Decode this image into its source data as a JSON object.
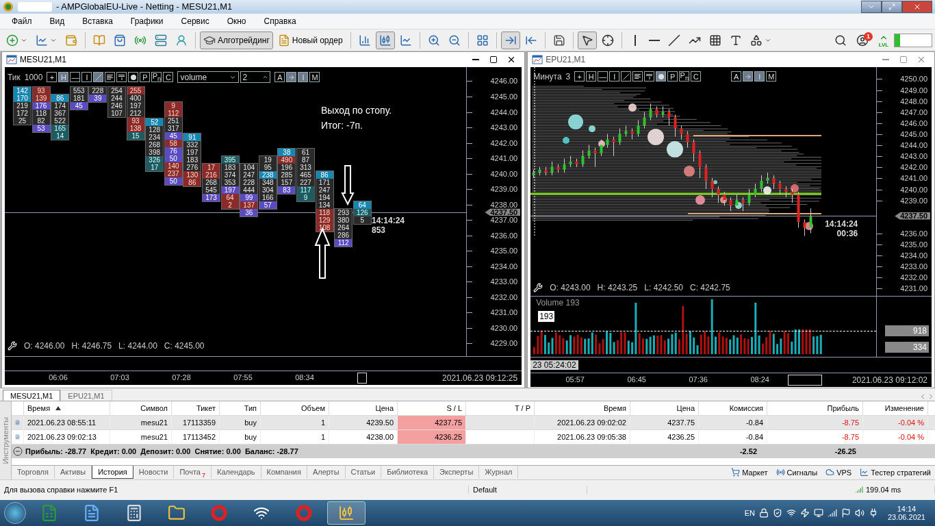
{
  "window": {
    "title": "- AMPGlobalEU-Live - Netting - MESU21,M1"
  },
  "menu": [
    "Файл",
    "Вид",
    "Вставка",
    "Графики",
    "Сервис",
    "Окно",
    "Справка"
  ],
  "toolbar": {
    "algo_button": {
      "label": "Алготрейдинг",
      "selected": true
    },
    "order_button": {
      "label": "Новый ордер"
    },
    "chart_modes": [
      {
        "selected": false
      },
      {
        "selected": true
      },
      {
        "selected": false
      }
    ],
    "autoscroll": {
      "selected": true
    },
    "cursor": {
      "selected": true
    },
    "notification_count": "1",
    "level_label": "LVL"
  },
  "charts": [
    {
      "kind": "footprint",
      "title": "MESU21,M1",
      "period_label": "Тик",
      "period_value": "1000",
      "tools": [
        {
          "kind": "char",
          "label": "+",
          "selected": false
        },
        {
          "kind": "char",
          "label": "H",
          "selected": true
        },
        {
          "kind": "char",
          "label": "—",
          "selected": false
        },
        {
          "kind": "char",
          "label": "I",
          "selected": false
        },
        {
          "kind": "slash",
          "selected": true
        },
        {
          "kind": "lines",
          "selected": false
        },
        {
          "kind": "strike",
          "selected": false
        },
        {
          "kind": "dot",
          "selected": false
        },
        {
          "kind": "char",
          "label": "P",
          "selected": false
        },
        {
          "kind": "char",
          "label": "P$_{n}$",
          "selected": false
        },
        {
          "kind": "char",
          "label": "C",
          "selected": false
        }
      ],
      "dropdown": {
        "value": "volume"
      },
      "spinner": {
        "value": "2"
      },
      "extra_tools": [
        {
          "kind": "char",
          "label": "A",
          "selected": false
        },
        {
          "kind": "arrow",
          "selected": true
        },
        {
          "kind": "char",
          "label": "I",
          "selected": true
        },
        {
          "kind": "char",
          "label": "M",
          "selected": false
        }
      ],
      "price_labels": [
        "4246.00",
        "4245.00",
        "4244.00",
        "4243.00",
        "4242.00",
        "4241.00",
        "4240.00",
        "4239.00",
        "4238.00",
        "4237.00",
        "4236.00",
        "4235.00",
        "4234.00",
        "4233.00",
        "4232.00",
        "4231.00",
        "4230.00",
        "4229.00"
      ],
      "price_marker": "4237.50",
      "last_time": "14:14:24",
      "last_value": "853",
      "note": [
        "Выход по стопу.",
        "Итог: -7п."
      ],
      "ohlc": [
        "O: 4246.00",
        "H: 4246.75",
        "L: 4244.00",
        "C: 4245.00"
      ],
      "time_labels": [
        "06:06",
        "07:03",
        "07:28",
        "07:55",
        "08:34"
      ],
      "date_label": "2021.06.23 09:12:25",
      "footprint": [
        [
          {
            "text": "142",
            "kind": "ask"
          },
          {
            "text": "170",
            "kind": "ask"
          },
          {
            "text": "219",
            "kind": "plain"
          },
          {
            "text": "172",
            "kind": "plain"
          },
          {
            "text": "25",
            "kind": "plain"
          }
        ],
        [
          {
            "text": "93",
            "kind": "red"
          },
          {
            "text": "139",
            "kind": "red"
          },
          {
            "text": "176",
            "kind": "bid"
          },
          {
            "text": "118",
            "kind": "plain"
          },
          {
            "text": "82",
            "kind": "plain"
          },
          {
            "text": "53",
            "kind": "bid"
          }
        ],
        [
          {
            "text": "86",
            "kind": "ask"
          },
          {
            "text": "174",
            "kind": "plain"
          },
          {
            "text": "367",
            "kind": "plain"
          },
          {
            "text": "522",
            "kind": "plain"
          },
          {
            "text": "165",
            "kind": "cyan"
          },
          {
            "text": "14",
            "kind": "cyan"
          }
        ],
        [
          {
            "text": "553",
            "kind": "plain"
          },
          {
            "text": "181",
            "kind": "plain"
          },
          {
            "text": "45",
            "kind": "bid"
          }
        ],
        [
          {
            "text": "228",
            "kind": "plain"
          },
          {
            "text": "39",
            "kind": "bid"
          }
        ],
        [
          {
            "text": "254",
            "kind": "plain"
          },
          {
            "text": "244",
            "kind": "plain"
          },
          {
            "text": "246",
            "kind": "plain"
          },
          {
            "text": "107",
            "kind": "plain"
          }
        ],
        [
          {
            "text": "255",
            "kind": "red"
          },
          {
            "text": "400",
            "kind": "plain"
          },
          {
            "text": "197",
            "kind": "plain"
          },
          {
            "text": "212",
            "kind": "plain"
          },
          {
            "text": "93",
            "kind": "red"
          },
          {
            "text": "138",
            "kind": "red"
          },
          {
            "text": "15",
            "kind": "cyan"
          }
        ],
        [
          {
            "text": "52",
            "kind": "ask"
          },
          {
            "text": "128",
            "kind": "plain"
          },
          {
            "text": "234",
            "kind": "plain"
          },
          {
            "text": "268",
            "kind": "plain"
          },
          {
            "text": "398",
            "kind": "plain"
          },
          {
            "text": "326",
            "kind": "cyan"
          },
          {
            "text": "17",
            "kind": "cyan"
          }
        ],
        [
          {
            "text": "9",
            "kind": "red"
          },
          {
            "text": "112",
            "kind": "red"
          },
          {
            "text": "251",
            "kind": "plain"
          },
          {
            "text": "317",
            "kind": "plain"
          },
          {
            "text": "45",
            "kind": "bid"
          },
          {
            "text": "58",
            "kind": "red"
          },
          {
            "text": "76",
            "kind": "bid"
          },
          {
            "text": "50",
            "kind": "bid"
          },
          {
            "text": "140",
            "kind": "red"
          },
          {
            "text": "237",
            "kind": "red"
          },
          {
            "text": "50",
            "kind": "bid"
          }
        ],
        [
          {
            "text": "91",
            "kind": "ask"
          },
          {
            "text": "332",
            "kind": "plain"
          },
          {
            "text": "197",
            "kind": "plain"
          },
          {
            "text": "183",
            "kind": "plain"
          },
          {
            "text": "276",
            "kind": "plain"
          },
          {
            "text": "130",
            "kind": "red"
          },
          {
            "text": "86",
            "kind": "red"
          }
        ],
        [
          {
            "text": "17",
            "kind": "red"
          },
          {
            "text": "216",
            "kind": "red"
          },
          {
            "text": "268",
            "kind": "plain"
          },
          {
            "text": "545",
            "kind": "plain"
          },
          {
            "text": "173",
            "kind": "bid"
          }
        ],
        [
          {
            "text": "395",
            "kind": "cyan"
          },
          {
            "text": "183",
            "kind": "plain"
          },
          {
            "text": "374",
            "kind": "plain"
          },
          {
            "text": "353",
            "kind": "plain"
          },
          {
            "text": "197",
            "kind": "bid"
          },
          {
            "text": "64",
            "kind": "red"
          },
          {
            "text": "2",
            "kind": "red"
          }
        ],
        [
          {
            "text": "104",
            "kind": "plain"
          },
          {
            "text": "247",
            "kind": "plain"
          },
          {
            "text": "228",
            "kind": "plain"
          },
          {
            "text": "444",
            "kind": "plain"
          },
          {
            "text": "99",
            "kind": "bid"
          },
          {
            "text": "137",
            "kind": "red"
          },
          {
            "text": "36",
            "kind": "bid"
          }
        ],
        [
          {
            "text": "19",
            "kind": "plain"
          },
          {
            "text": "95",
            "kind": "plain"
          },
          {
            "text": "238",
            "kind": "ask"
          },
          {
            "text": "348",
            "kind": "plain"
          },
          {
            "text": "304",
            "kind": "plain"
          },
          {
            "text": "166",
            "kind": "plain"
          },
          {
            "text": "57",
            "kind": "bid"
          }
        ],
        [
          {
            "text": "38",
            "kind": "ask"
          },
          {
            "text": "490",
            "kind": "red"
          },
          {
            "text": "196",
            "kind": "plain"
          },
          {
            "text": "285",
            "kind": "plain"
          },
          {
            "text": "157",
            "kind": "plain"
          },
          {
            "text": "83",
            "kind": "bid"
          }
        ],
        [
          {
            "text": "61",
            "kind": "plain"
          },
          {
            "text": "87",
            "kind": "plain"
          },
          {
            "text": "313",
            "kind": "plain"
          },
          {
            "text": "465",
            "kind": "plain"
          },
          {
            "text": "227",
            "kind": "plain"
          },
          {
            "text": "117",
            "kind": "cyan"
          },
          {
            "text": "9",
            "kind": "cyan"
          }
        ],
        [
          {
            "text": "86",
            "kind": "ask"
          },
          {
            "text": "171",
            "kind": "plain"
          },
          {
            "text": "247",
            "kind": "plain"
          },
          {
            "text": "194",
            "kind": "plain"
          },
          {
            "text": "134",
            "kind": "plain"
          },
          {
            "text": "118",
            "kind": "red"
          },
          {
            "text": "129",
            "kind": "red"
          },
          {
            "text": "108",
            "kind": "red"
          }
        ],
        [
          {
            "text": "293",
            "kind": "plain"
          },
          {
            "text": "380",
            "kind": "plain"
          },
          {
            "text": "264",
            "kind": "plain"
          },
          {
            "text": "286",
            "kind": "plain"
          },
          {
            "text": "112",
            "kind": "bid"
          }
        ],
        [
          {
            "text": "64",
            "kind": "ask"
          },
          {
            "text": "126",
            "kind": "cyan"
          },
          {
            "text": "5",
            "kind": "plain"
          }
        ]
      ]
    },
    {
      "kind": "candles",
      "title": "EPU21,M1",
      "period_label": "Минута",
      "period_value": "3",
      "tools": [
        {
          "kind": "char",
          "label": "+",
          "selected": false
        },
        {
          "kind": "char",
          "label": "H",
          "selected": false
        },
        {
          "kind": "char",
          "label": "—",
          "selected": false
        },
        {
          "kind": "char",
          "label": "I",
          "selected": false
        },
        {
          "kind": "slash",
          "selected": false
        },
        {
          "kind": "lines",
          "selected": false
        },
        {
          "kind": "strike",
          "selected": false
        },
        {
          "kind": "dot",
          "selected": true
        },
        {
          "kind": "char",
          "label": "P",
          "selected": false
        },
        {
          "kind": "char",
          "label": "P$_{n}$",
          "selected": false
        },
        {
          "kind": "char",
          "label": "C",
          "selected": false
        }
      ],
      "extra_tools": [
        {
          "kind": "char",
          "label": "A",
          "selected": false
        },
        {
          "kind": "arrow",
          "selected": true
        },
        {
          "kind": "char",
          "label": "I",
          "selected": true
        },
        {
          "kind": "char",
          "label": "M",
          "selected": false
        }
      ],
      "price_marker": "4237.50",
      "last_time": "14:14:24",
      "last_value": "00:36",
      "ohlc": [
        "O: 4243.00",
        "H: 4243.25",
        "L: 4242.50",
        "C: 4242.75"
      ],
      "chart_data": {
        "type": "candlestick",
        "ylim": [
          4231,
          4250
        ],
        "yticks": [
          {
            "value": 4250,
            "label": "4250.00"
          },
          {
            "value": 4249,
            "label": "4249.00"
          },
          {
            "value": 4248,
            "label": "4248.00"
          },
          {
            "value": 4247,
            "label": "4247.00"
          },
          {
            "value": 4246,
            "label": "4246.00"
          },
          {
            "value": 4245,
            "label": "4245.00"
          },
          {
            "value": 4244,
            "label": "4244.00"
          },
          {
            "value": 4243,
            "label": "4243.00"
          },
          {
            "value": 4242,
            "label": "4242.00"
          },
          {
            "value": 4241,
            "label": "4241.00"
          },
          {
            "value": 4240,
            "label": "4240.00"
          },
          {
            "value": 4239,
            "label": "4239.00"
          },
          {
            "value": 4236,
            "label": "4236.00"
          },
          {
            "value": 4235,
            "label": "4235.00"
          },
          {
            "value": 4234,
            "label": "4234.00"
          },
          {
            "value": 4233,
            "label": "4233.00"
          },
          {
            "value": 4232,
            "label": "4232.00"
          },
          {
            "value": 4231,
            "label": "4231.00"
          }
        ],
        "categories": [
          null,
          null,
          null,
          null,
          null,
          null,
          null,
          null,
          null,
          null,
          null,
          null,
          null,
          null,
          null,
          null,
          null,
          null,
          null,
          null,
          null,
          null,
          null,
          null,
          null,
          null,
          null,
          null,
          null,
          null,
          null,
          null,
          null,
          null,
          null,
          null,
          null,
          null,
          null,
          null,
          null,
          null,
          null,
          null,
          null,
          null,
          null,
          null,
          null,
          null,
          null,
          null,
          null,
          null,
          null,
          null
        ],
        "ohlc": [
          [
            4241.25,
            4241.75,
            4241,
            4241.5
          ],
          [
            4241.5,
            4242,
            4241.25,
            4241.75
          ],
          [
            4241.75,
            4242,
            4241.25,
            4241.5
          ],
          [
            4241.5,
            4242.5,
            4241.25,
            4242
          ],
          [
            4242,
            4242.25,
            4241.5,
            4241.75
          ],
          [
            4241.75,
            4242.75,
            4241.5,
            4242.25
          ],
          [
            4242.25,
            4243,
            4242,
            4242.5
          ],
          [
            4242.5,
            4242.75,
            4242,
            4242.25
          ],
          [
            4242.25,
            4243.5,
            4242,
            4243
          ],
          [
            4243,
            4244,
            4242.75,
            4243.5
          ],
          [
            4243.5,
            4243.75,
            4242,
            4243.25
          ],
          [
            4243.25,
            4244.5,
            4243,
            4244
          ],
          [
            4244,
            4245,
            4243.75,
            4244.5
          ],
          [
            4244.5,
            4244.75,
            4243,
            4244.25
          ],
          [
            4244.25,
            4245.5,
            4244,
            4245
          ],
          [
            4245,
            4245.75,
            4244.75,
            4245.25
          ],
          [
            4245.25,
            4245.5,
            4244.5,
            4245
          ],
          [
            4245,
            4246.25,
            4244.75,
            4245.75
          ],
          [
            4245.75,
            4247,
            4245.5,
            4246.5
          ],
          [
            4246.5,
            4247.75,
            4246.25,
            4247.25
          ],
          [
            4247.25,
            4247.5,
            4246.5,
            4246.75
          ],
          [
            4246.75,
            4247.5,
            4246.5,
            4247
          ],
          [
            4247,
            4247.25,
            4245.75,
            4246.5
          ],
          [
            4246.5,
            4246.75,
            4244.75,
            4245.5
          ],
          [
            4245.5,
            4245.75,
            4244.5,
            4245
          ],
          [
            4245,
            4245.25,
            4243.75,
            4244.25
          ],
          [
            4244.25,
            4244.5,
            4242.5,
            4243.25
          ],
          [
            4243.25,
            4243.5,
            4241,
            4242
          ],
          [
            4242,
            4242.25,
            4240,
            4240.75
          ],
          [
            4240.75,
            4241,
            4239.25,
            4240
          ],
          [
            4240,
            4240.25,
            4238.75,
            4239.5
          ],
          [
            4239.5,
            4239.75,
            4238.5,
            4239
          ],
          [
            4239,
            4239.25,
            4238,
            4238.5
          ],
          [
            4238.5,
            4239.5,
            4238.25,
            4239
          ],
          [
            4239,
            4239.25,
            4238,
            4238.75
          ],
          [
            4238.75,
            4240,
            4238.5,
            4239.5
          ],
          [
            4239.5,
            4240.5,
            4239.25,
            4240
          ],
          [
            4240,
            4241.25,
            4239.75,
            4240.75
          ],
          [
            4240.75,
            4241.5,
            4240.5,
            4241
          ],
          [
            4241,
            4241.25,
            4240,
            4240.5
          ],
          [
            4240.5,
            4240.75,
            4239.5,
            4240
          ],
          [
            4240,
            4240.25,
            4239.25,
            4239.75
          ],
          [
            4239.75,
            4240,
            4238.75,
            4239.5
          ],
          [
            4239.5,
            4239.75,
            4236.5,
            4237
          ],
          [
            4237,
            4237.25,
            4235.75,
            4236.5
          ],
          [
            4236.5,
            4238.25,
            4236,
            4237.5
          ],
          null,
          null,
          null,
          null,
          null,
          null,
          null,
          null,
          null,
          null
        ]
      },
      "volume": {
        "title": "Volume 193",
        "value": "193",
        "levels": [
          "918",
          "334"
        ],
        "cursor_time": "23 05:24:02"
      },
      "time_labels": [
        "05:57",
        "06:45",
        "07:36",
        "08:24"
      ],
      "date_label": "2021.06.23 09:12:02"
    }
  ],
  "chart_tabs": [
    {
      "label": "MESU21,M1",
      "selected": true
    },
    {
      "label": "EPU21,M1",
      "selected": false
    }
  ],
  "terminal": {
    "side_label": "Инструменты",
    "columns": [
      {
        "label": "Время",
        "sorted": true
      },
      {
        "label": "Символ",
        "sorted": false
      },
      {
        "label": "Тикет",
        "sorted": false
      },
      {
        "label": "Тип",
        "sorted": false
      },
      {
        "label": "Объем",
        "sorted": false
      },
      {
        "label": "Цена",
        "sorted": false
      },
      {
        "label": "S / L",
        "sorted": false
      },
      {
        "label": "T / P",
        "sorted": false
      },
      {
        "label": "Время",
        "sorted": false
      },
      {
        "label": "Цена",
        "sorted": false
      },
      {
        "label": "Комиссия",
        "sorted": false
      },
      {
        "label": "Прибыль",
        "sorted": false
      },
      {
        "label": "Изменение",
        "sorted": false
      }
    ],
    "rows": [
      {
        "selected": true,
        "time": "2021.06.23 08:55:11",
        "symbol": "mesu21",
        "ticket": "17113359",
        "type": "buy",
        "volume": "1",
        "price": "4239.50",
        "sl": "4237.75",
        "close_time": "2021.06.23 09:02:02",
        "close_price": "4237.75",
        "commission": "-0.84",
        "profit": "-8.75",
        "change": "-0.04 %"
      },
      {
        "selected": false,
        "time": "2021.06.23 09:02:13",
        "symbol": "mesu21",
        "ticket": "17113452",
        "type": "buy",
        "volume": "1",
        "price": "4238.00",
        "sl": "4236.25",
        "close_time": "2021.06.23 09:05:38",
        "close_price": "4236.25",
        "commission": "-0.84",
        "profit": "-8.75",
        "change": "-0.04 %"
      }
    ],
    "summary": {
      "text": "Прибыль: -28.77  Кредит: 0.00  Депозит: 0.00  Снятие: 0.00  Баланс: -28.77",
      "commission": "-2.52",
      "profit": "-26.25"
    },
    "tabs": [
      {
        "label": "Торговля",
        "selected": false
      },
      {
        "label": "Активы",
        "selected": false
      },
      {
        "label": "История",
        "selected": true
      },
      {
        "label": "Новости",
        "selected": false
      },
      {
        "label": "Почта",
        "badge": "7",
        "selected": false
      },
      {
        "label": "Календарь",
        "selected": false
      },
      {
        "label": "Компания",
        "selected": false
      },
      {
        "label": "Алерты",
        "selected": false
      },
      {
        "label": "Статьи",
        "selected": false
      },
      {
        "label": "Библиотека",
        "selected": false
      },
      {
        "label": "Эксперты",
        "selected": false
      },
      {
        "label": "Журнал",
        "selected": false
      }
    ],
    "links": [
      "Маркет",
      "Сигналы",
      "VPS",
      "Тестер стратегий"
    ]
  },
  "status_bar": {
    "help": "Для вызова справки нажмите F1",
    "profile": "Default",
    "ping": "199.04 ms"
  },
  "taskbar": {
    "language": "EN",
    "time": "14:14",
    "date": "23.06.2021"
  }
}
